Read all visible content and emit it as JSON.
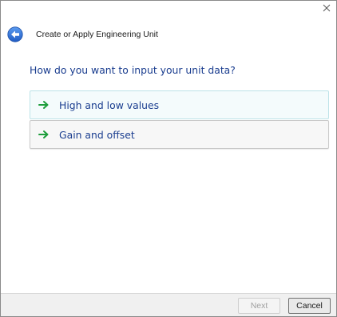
{
  "window": {
    "title": "Create or Apply Engineering Unit"
  },
  "icons": {
    "close": "close-icon",
    "back": "back-arrow-icon",
    "option_arrow": "green-arrow-right-icon"
  },
  "main": {
    "question": "How do you want to input your unit data?",
    "options": [
      {
        "label": "High and low values"
      },
      {
        "label": "Gain and offset"
      }
    ]
  },
  "footer": {
    "next_label": "Next",
    "cancel_label": "Cancel"
  },
  "colors": {
    "heading_blue": "#1a3d8f",
    "arrow_green": "#1e9e3c",
    "back_button_blue": "#2d6fd6"
  }
}
